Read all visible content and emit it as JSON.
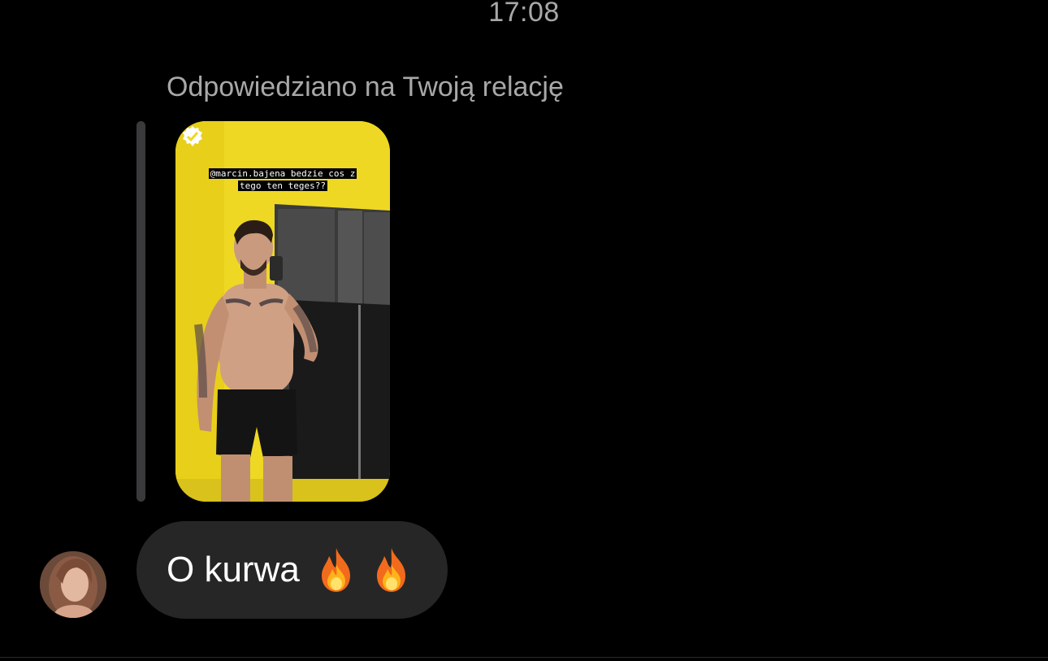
{
  "chat": {
    "timestamp": "17:08",
    "reply_caption": "Odpowiedziano na Twoją relację"
  },
  "story": {
    "caption_line1": "@marcin.bajena bedzie cos z",
    "caption_line2": "tego ten teges??",
    "check_icon": "verified-badge-icon"
  },
  "message": {
    "text": "O kurwa",
    "emoji_icons": [
      "fire-icon",
      "fire-icon"
    ]
  },
  "colors": {
    "background": "#000000",
    "secondary_text": "#a8a8a8",
    "bubble": "#262626",
    "reply_bar": "#3a3a3c",
    "story_bg": "#f2dc1e"
  }
}
